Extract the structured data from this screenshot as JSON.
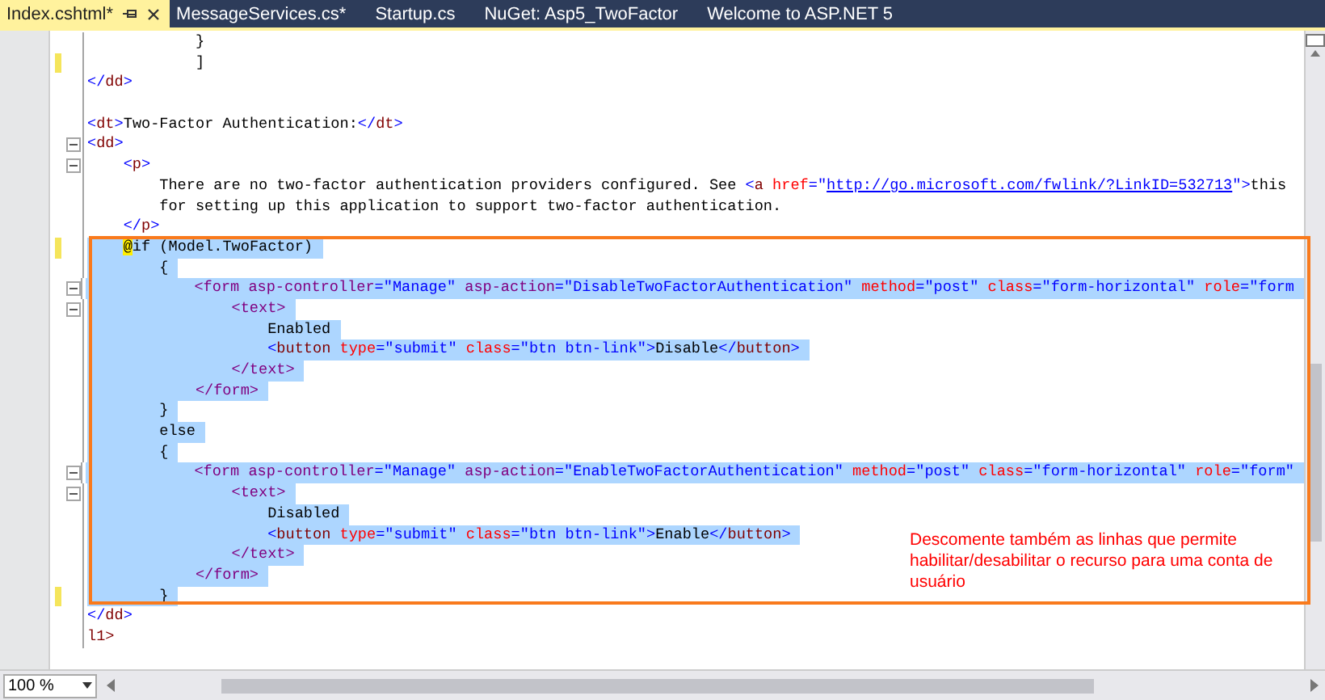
{
  "tabs": [
    {
      "label": "Index.cshtml*",
      "selected": true
    },
    {
      "label": "MessageServices.cs*",
      "selected": false
    },
    {
      "label": "Startup.cs",
      "selected": false
    },
    {
      "label": "NuGet: Asp5_TwoFactor",
      "selected": false
    },
    {
      "label": "Welcome to ASP.NET 5",
      "selected": false
    }
  ],
  "lines": [
    {
      "selected": false,
      "changed": false,
      "fold": false,
      "tokens": [
        {
          "kind": "text",
          "t": "            }"
        }
      ]
    },
    {
      "selected": false,
      "changed": true,
      "fold": false,
      "tokens": [
        {
          "kind": "text",
          "t": "            ]"
        }
      ]
    },
    {
      "selected": false,
      "changed": false,
      "fold": false,
      "tokens": [
        {
          "kind": "p",
          "t": "</"
        },
        {
          "kind": "tag",
          "t": "dd"
        },
        {
          "kind": "p",
          "t": ">"
        }
      ]
    },
    {
      "changed": false,
      "fold": false
    },
    {
      "selected": false,
      "changed": false,
      "fold": false,
      "tokens": [
        {
          "kind": "p",
          "t": "<"
        },
        {
          "kind": "tag",
          "t": "dt"
        },
        {
          "kind": "p",
          "t": ">"
        },
        {
          "kind": "text",
          "t": "Two-Factor Authentication:"
        },
        {
          "kind": "p",
          "t": "</"
        },
        {
          "kind": "tag",
          "t": "dt"
        },
        {
          "kind": "p",
          "t": ">"
        }
      ]
    },
    {
      "selected": false,
      "changed": false,
      "fold": true,
      "tokens": [
        {
          "kind": "p",
          "t": "<"
        },
        {
          "kind": "tag",
          "t": "dd"
        },
        {
          "kind": "p",
          "t": ">"
        }
      ]
    },
    {
      "selected": false,
      "changed": false,
      "fold": true,
      "tokens": [
        {
          "kind": "p",
          "t": "    <"
        },
        {
          "kind": "tag",
          "t": "p"
        },
        {
          "kind": "p",
          "t": ">"
        }
      ]
    },
    {
      "selected": false,
      "changed": false,
      "fold": false,
      "tokens": [
        {
          "kind": "text",
          "t": "        There are no two-factor authentication providers configured. See "
        },
        {
          "kind": "p",
          "t": "<"
        },
        {
          "kind": "tag",
          "t": "a"
        },
        {
          "kind": "attr",
          "t": " href"
        },
        {
          "kind": "p",
          "t": "=\""
        },
        {
          "kind": "link",
          "t": "http://go.microsoft.com/fwlink/?LinkID=532713"
        },
        {
          "kind": "p",
          "t": "\">"
        },
        {
          "kind": "text",
          "t": "this"
        }
      ]
    },
    {
      "selected": false,
      "changed": false,
      "fold": false,
      "tokens": [
        {
          "kind": "text",
          "t": "        for setting up this application to support two-factor authentication."
        }
      ]
    },
    {
      "selected": false,
      "changed": false,
      "fold": false,
      "tokens": [
        {
          "kind": "p",
          "t": "    </"
        },
        {
          "kind": "tag",
          "t": "p"
        },
        {
          "kind": "p",
          "t": ">"
        }
      ]
    },
    {
      "selected": true,
      "changed": true,
      "fold": false,
      "tokens": [
        {
          "kind": "razor",
          "t": "    @"
        },
        {
          "kind": "text",
          "t": "if (Model.TwoFactor)"
        }
      ]
    },
    {
      "selected": true,
      "changed": false,
      "fold": false,
      "tokens": [
        {
          "kind": "text",
          "t": "        {"
        }
      ]
    },
    {
      "selected": true,
      "changed": false,
      "fold": true,
      "tokens": [
        {
          "kind": "helper",
          "t": "            <form"
        },
        {
          "kind": "helper",
          "t": " asp-controller"
        },
        {
          "kind": "p",
          "t": "="
        },
        {
          "kind": "value",
          "t": "\"Manage\""
        },
        {
          "kind": "helper",
          "t": " asp-action"
        },
        {
          "kind": "p",
          "t": "="
        },
        {
          "kind": "value",
          "t": "\"DisableTwoFactorAuthentication\""
        },
        {
          "kind": "attr",
          "t": " method"
        },
        {
          "kind": "p",
          "t": "="
        },
        {
          "kind": "value",
          "t": "\"post\""
        },
        {
          "kind": "attr",
          "t": " class"
        },
        {
          "kind": "p",
          "t": "="
        },
        {
          "kind": "value",
          "t": "\"form-horizontal\""
        },
        {
          "kind": "attr",
          "t": " role"
        },
        {
          "kind": "p",
          "t": "="
        },
        {
          "kind": "value",
          "t": "\"form"
        }
      ]
    },
    {
      "selected": true,
      "changed": false,
      "fold": true,
      "tokens": [
        {
          "kind": "helper",
          "t": "                <text>"
        }
      ]
    },
    {
      "selected": true,
      "changed": false,
      "fold": false,
      "tokens": [
        {
          "kind": "text",
          "t": "                    Enabled"
        }
      ]
    },
    {
      "selected": true,
      "changed": false,
      "fold": false,
      "tokens": [
        {
          "kind": "p",
          "t": "                    <"
        },
        {
          "kind": "tag",
          "t": "button"
        },
        {
          "kind": "attr",
          "t": " type"
        },
        {
          "kind": "p",
          "t": "="
        },
        {
          "kind": "value",
          "t": "\"submit\""
        },
        {
          "kind": "attr",
          "t": " class"
        },
        {
          "kind": "p",
          "t": "="
        },
        {
          "kind": "value",
          "t": "\"btn btn-link\""
        },
        {
          "kind": "p",
          "t": ">"
        },
        {
          "kind": "text",
          "t": "Disable"
        },
        {
          "kind": "p",
          "t": "</"
        },
        {
          "kind": "tag",
          "t": "button"
        },
        {
          "kind": "p",
          "t": ">"
        }
      ]
    },
    {
      "selected": true,
      "changed": false,
      "fold": false,
      "tokens": [
        {
          "kind": "helper",
          "t": "                </text>"
        }
      ]
    },
    {
      "selected": true,
      "changed": false,
      "fold": false,
      "tokens": [
        {
          "kind": "helper",
          "t": "            </form>"
        }
      ]
    },
    {
      "selected": true,
      "changed": false,
      "fold": false,
      "tokens": [
        {
          "kind": "text",
          "t": "        }"
        }
      ]
    },
    {
      "selected": true,
      "changed": false,
      "fold": false,
      "tokens": [
        {
          "kind": "text",
          "t": "        else"
        }
      ]
    },
    {
      "selected": true,
      "changed": false,
      "fold": false,
      "tokens": [
        {
          "kind": "text",
          "t": "        {"
        }
      ]
    },
    {
      "selected": true,
      "changed": false,
      "fold": true,
      "tokens": [
        {
          "kind": "helper",
          "t": "            <form"
        },
        {
          "kind": "helper",
          "t": " asp-controller"
        },
        {
          "kind": "p",
          "t": "="
        },
        {
          "kind": "value",
          "t": "\"Manage\""
        },
        {
          "kind": "helper",
          "t": " asp-action"
        },
        {
          "kind": "p",
          "t": "="
        },
        {
          "kind": "value",
          "t": "\"EnableTwoFactorAuthentication\""
        },
        {
          "kind": "attr",
          "t": " method"
        },
        {
          "kind": "p",
          "t": "="
        },
        {
          "kind": "value",
          "t": "\"post\""
        },
        {
          "kind": "attr",
          "t": " class"
        },
        {
          "kind": "p",
          "t": "="
        },
        {
          "kind": "value",
          "t": "\"form-horizontal\""
        },
        {
          "kind": "attr",
          "t": " role"
        },
        {
          "kind": "p",
          "t": "="
        },
        {
          "kind": "value",
          "t": "\"form\""
        }
      ]
    },
    {
      "selected": true,
      "changed": false,
      "fold": true,
      "tokens": [
        {
          "kind": "helper",
          "t": "                <text>"
        }
      ]
    },
    {
      "selected": true,
      "changed": false,
      "fold": false,
      "tokens": [
        {
          "kind": "text",
          "t": "                    Disabled"
        }
      ]
    },
    {
      "selected": true,
      "changed": false,
      "fold": false,
      "tokens": [
        {
          "kind": "p",
          "t": "                    <"
        },
        {
          "kind": "tag",
          "t": "button"
        },
        {
          "kind": "attr",
          "t": " type"
        },
        {
          "kind": "p",
          "t": "="
        },
        {
          "kind": "value",
          "t": "\"submit\""
        },
        {
          "kind": "attr",
          "t": " class"
        },
        {
          "kind": "p",
          "t": "="
        },
        {
          "kind": "value",
          "t": "\"btn btn-link\""
        },
        {
          "kind": "p",
          "t": ">"
        },
        {
          "kind": "text",
          "t": "Enable"
        },
        {
          "kind": "p",
          "t": "</"
        },
        {
          "kind": "tag",
          "t": "button"
        },
        {
          "kind": "p",
          "t": ">"
        }
      ]
    },
    {
      "selected": true,
      "changed": false,
      "fold": false,
      "tokens": [
        {
          "kind": "helper",
          "t": "                </text>"
        }
      ]
    },
    {
      "selected": true,
      "changed": false,
      "fold": false,
      "tokens": [
        {
          "kind": "helper",
          "t": "            </form>"
        }
      ]
    },
    {
      "selected": true,
      "changed": true,
      "fold": false,
      "tokens": [
        {
          "kind": "text",
          "t": "        }"
        }
      ]
    },
    {
      "selected": false,
      "changed": false,
      "fold": false,
      "tokens": [
        {
          "kind": "p",
          "t": "</"
        },
        {
          "kind": "tag",
          "t": "dd"
        },
        {
          "kind": "p",
          "t": ">"
        }
      ]
    },
    {
      "selected": false,
      "changed": false,
      "fold": false,
      "tokens": [
        {
          "kind": "tag",
          "t": "l1>"
        }
      ]
    }
  ],
  "annotation": "Descomente também as linhas que permite habilitar/desabilitar o recurso para uma conta de usuário",
  "zoom": {
    "value": "100 %"
  }
}
